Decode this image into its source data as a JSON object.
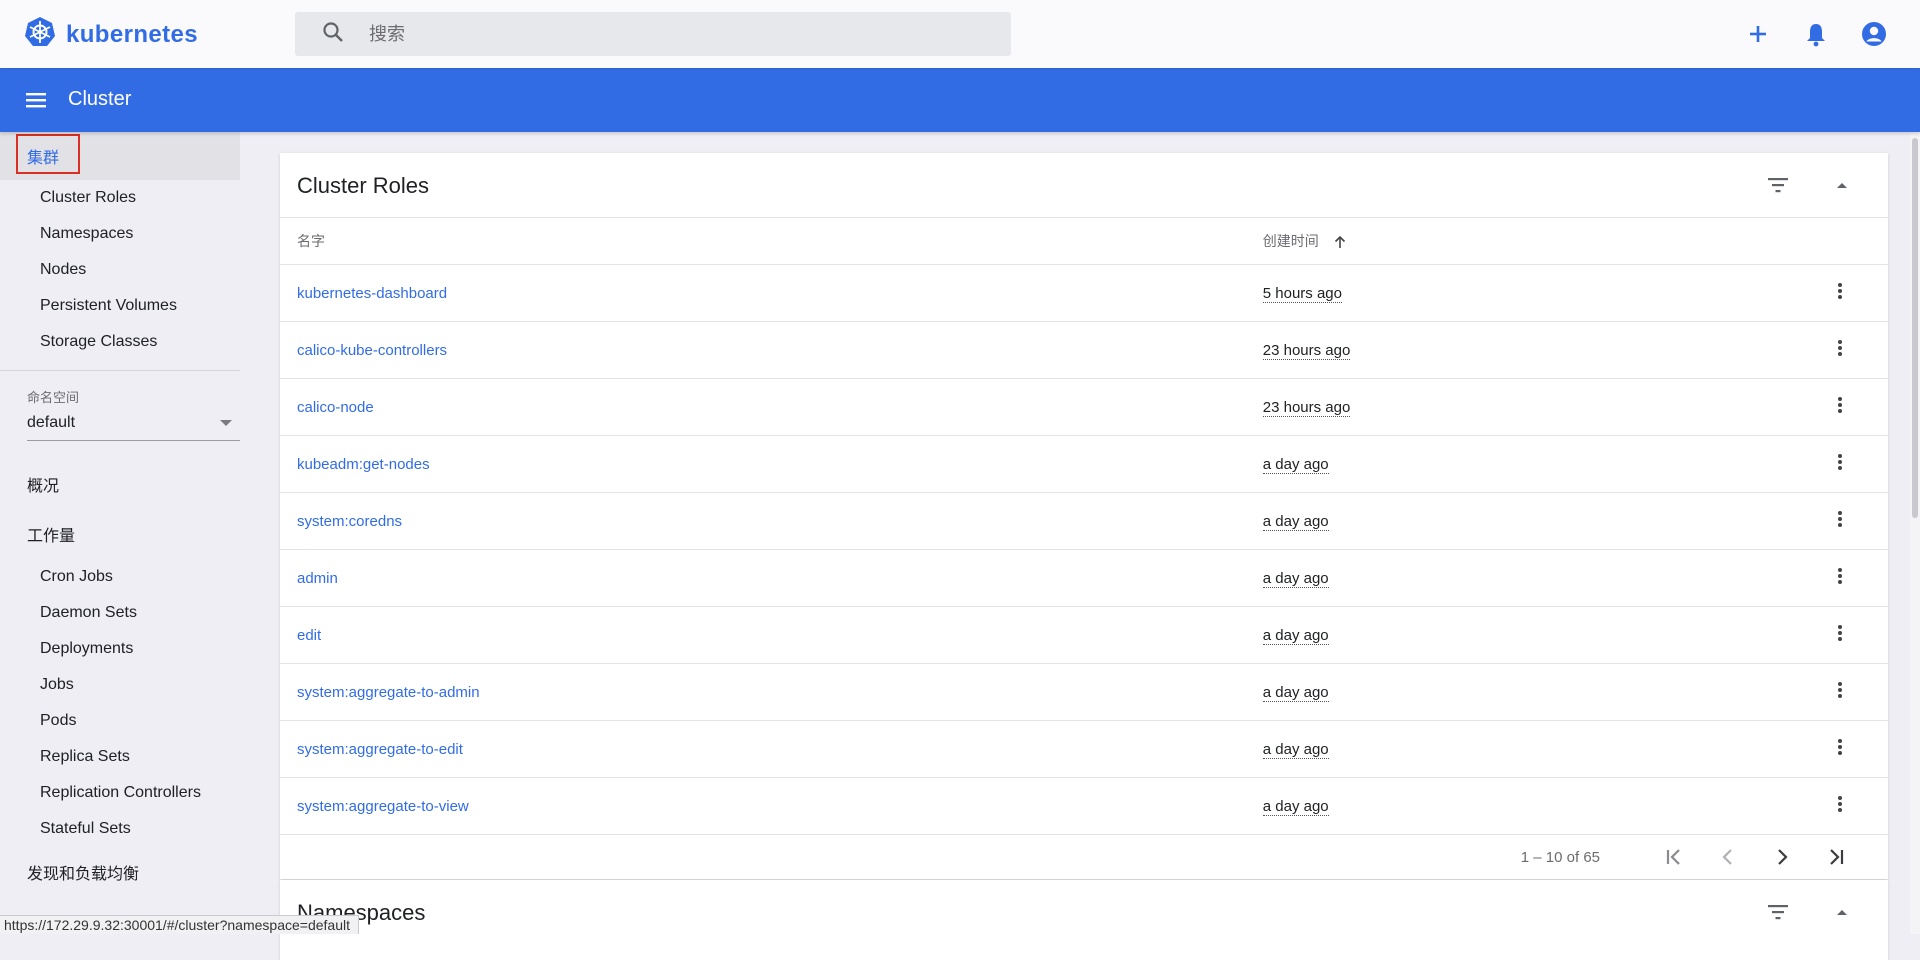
{
  "header": {
    "logo_text": "kubernetes",
    "search_placeholder": "搜索"
  },
  "toolbar": {
    "title": "Cluster"
  },
  "sidebar": {
    "cluster_section": "集群",
    "cluster_items": [
      "Cluster Roles",
      "Namespaces",
      "Nodes",
      "Persistent Volumes",
      "Storage Classes"
    ],
    "namespace_label": "命名空间",
    "namespace_value": "default",
    "overview": "概况",
    "workloads": "工作量",
    "workload_items": [
      "Cron Jobs",
      "Daemon Sets",
      "Deployments",
      "Jobs",
      "Pods",
      "Replica Sets",
      "Replication Controllers",
      "Stateful Sets"
    ],
    "discovery": "发现和负载均衡"
  },
  "cluster_roles": {
    "title": "Cluster Roles",
    "col_name": "名字",
    "col_created": "创建时间",
    "rows": [
      {
        "name": "kubernetes-dashboard",
        "age": "5 hours ago"
      },
      {
        "name": "calico-kube-controllers",
        "age": "23 hours ago"
      },
      {
        "name": "calico-node",
        "age": "23 hours ago"
      },
      {
        "name": "kubeadm:get-nodes",
        "age": "a day ago"
      },
      {
        "name": "system:coredns",
        "age": "a day ago"
      },
      {
        "name": "admin",
        "age": "a day ago"
      },
      {
        "name": "edit",
        "age": "a day ago"
      },
      {
        "name": "system:aggregate-to-admin",
        "age": "a day ago"
      },
      {
        "name": "system:aggregate-to-edit",
        "age": "a day ago"
      },
      {
        "name": "system:aggregate-to-view",
        "age": "a day ago"
      }
    ],
    "pagination": "1 – 10 of 65"
  },
  "namespaces_card": {
    "title": "Namespaces"
  },
  "status_url": "https://172.29.9.32:30001/#/cluster?namespace=default",
  "colors": {
    "brand": "#326ce5",
    "highlight": "#d93025"
  }
}
